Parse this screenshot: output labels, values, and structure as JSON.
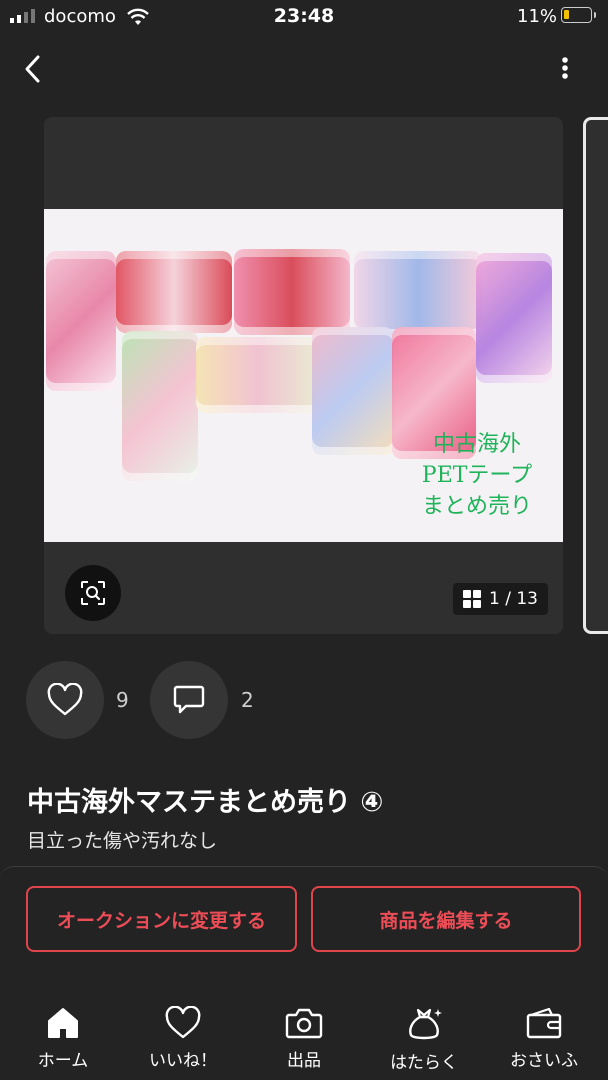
{
  "status_bar": {
    "carrier": "docomo",
    "time": "23:48",
    "battery": "11%"
  },
  "product": {
    "photo_caption_lines": [
      "中古海外",
      "PETテープ",
      "まとめ売り"
    ],
    "image_counter": "1 / 13",
    "likes_count": "9",
    "comments_count": "2",
    "title": "中古海外マステまとめ売り ④",
    "condition": "目立った傷や汚れなし"
  },
  "action_sheet": {
    "auction_button": "オークションに変更する",
    "edit_button": "商品を編集する"
  },
  "tab_bar": [
    {
      "label": "ホーム",
      "icon": "home-icon"
    },
    {
      "label": "いいね！",
      "icon": "heart-icon"
    },
    {
      "label": "出品",
      "icon": "camera-icon"
    },
    {
      "label": "はたらく",
      "icon": "money-bag-icon"
    },
    {
      "label": "おさいふ",
      "icon": "wallet-icon"
    }
  ],
  "colors": {
    "accent": "#ec4d56",
    "background": "#232323"
  }
}
